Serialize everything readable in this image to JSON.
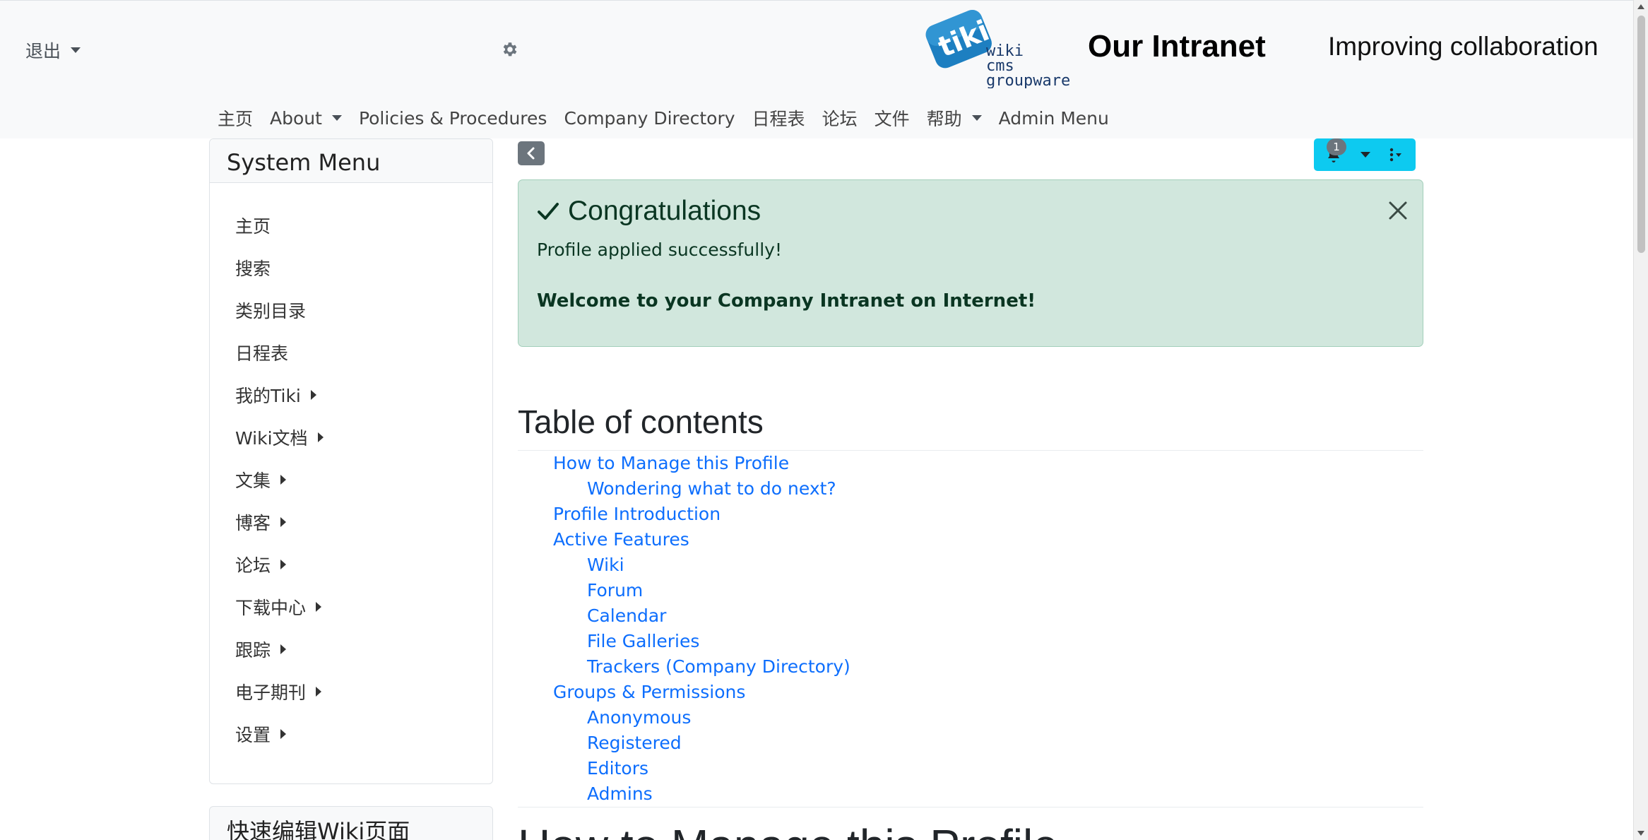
{
  "header": {
    "logout_label": "退出",
    "site_title": "Our Intranet",
    "site_slogan": "Improving collaboration",
    "logo": {
      "brand": "tiki",
      "line1": "wiki",
      "line2": "cms",
      "line3": "groupware",
      "color": "#1d7fc1"
    }
  },
  "topnav": {
    "items": [
      {
        "label": "主页",
        "dropdown": false
      },
      {
        "label": "About",
        "dropdown": true
      },
      {
        "label": "Policies & Procedures",
        "dropdown": false
      },
      {
        "label": "Company Directory",
        "dropdown": false
      },
      {
        "label": "日程表",
        "dropdown": false
      },
      {
        "label": "论坛",
        "dropdown": false
      },
      {
        "label": "文件",
        "dropdown": false
      },
      {
        "label": "帮助",
        "dropdown": true
      },
      {
        "label": "Admin Menu",
        "dropdown": false
      }
    ]
  },
  "sidebar": {
    "title": "System Menu",
    "items": [
      {
        "label": "主页",
        "submenu": false
      },
      {
        "label": "搜索",
        "submenu": false
      },
      {
        "label": "类别目录",
        "submenu": false
      },
      {
        "label": "日程表",
        "submenu": false
      },
      {
        "label": "我的Tiki",
        "submenu": true
      },
      {
        "label": "Wiki文档",
        "submenu": true
      },
      {
        "label": "文集",
        "submenu": true
      },
      {
        "label": "博客",
        "submenu": true
      },
      {
        "label": "论坛",
        "submenu": true
      },
      {
        "label": "下载中心",
        "submenu": true
      },
      {
        "label": "跟踪",
        "submenu": true
      },
      {
        "label": "电子期刊",
        "submenu": true
      },
      {
        "label": "设置",
        "submenu": true
      }
    ],
    "quick_edit_title": "快速编辑Wiki页面"
  },
  "actions": {
    "notification_count": "1",
    "accent": "#0dcaf0"
  },
  "alert": {
    "heading": "Congratulations",
    "message": "Profile applied successfully!",
    "welcome": "Welcome to your Company Intranet on Internet!",
    "color": "#d1e7dd"
  },
  "toc": {
    "title": "Table of contents",
    "items": [
      {
        "label": "How to Manage this Profile",
        "level": 1
      },
      {
        "label": "Wondering what to do next?",
        "level": 2
      },
      {
        "label": "Profile Introduction",
        "level": 1
      },
      {
        "label": "Active Features",
        "level": 1
      },
      {
        "label": "Wiki",
        "level": 2
      },
      {
        "label": "Forum",
        "level": 2
      },
      {
        "label": "Calendar",
        "level": 2
      },
      {
        "label": "File Galleries",
        "level": 2
      },
      {
        "label": "Trackers (Company Directory)",
        "level": 2
      },
      {
        "label": "Groups & Permissions",
        "level": 1
      },
      {
        "label": "Anonymous",
        "level": 2
      },
      {
        "label": "Registered",
        "level": 2
      },
      {
        "label": "Editors",
        "level": 2
      },
      {
        "label": "Admins",
        "level": 2
      }
    ],
    "link_color": "#0d6efd"
  },
  "content": {
    "next_heading": "How to Manage this Profile"
  }
}
